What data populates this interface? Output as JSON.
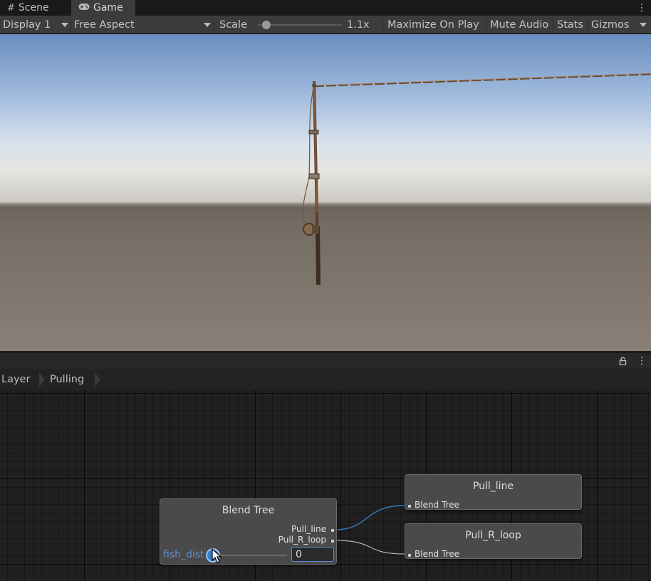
{
  "tabs": [
    {
      "label": "Scene",
      "icon": "grid-icon"
    },
    {
      "label": "Game",
      "icon": "gamepad-icon"
    }
  ],
  "toolbar": {
    "display": "Display 1",
    "aspect": "Free Aspect",
    "scale_label": "Scale",
    "scale_value": "1.1x",
    "scale_level": 0.05,
    "maximize": "Maximize On Play",
    "mute": "Mute Audio",
    "stats": "Stats",
    "gizmos": "Gizmos"
  },
  "animator": {
    "breadcrumbs": [
      "Layer",
      "Pulling"
    ],
    "blend_tree": {
      "title": "Blend Tree",
      "outputs": [
        "Pull_line",
        "Pull_R_loop"
      ],
      "parameter": "fish_dist",
      "value": "0",
      "slider_level": 0
    },
    "motion_nodes": [
      {
        "title": "Pull_line",
        "port_label": "Blend Tree"
      },
      {
        "title": "Pull_R_loop",
        "port_label": "Blend Tree"
      }
    ]
  },
  "colors": {
    "accent": "#2f7fd0",
    "parameter_text": "#5b8fd8",
    "link_active": "#3a78c0",
    "link_inactive": "#b8b8b8"
  }
}
